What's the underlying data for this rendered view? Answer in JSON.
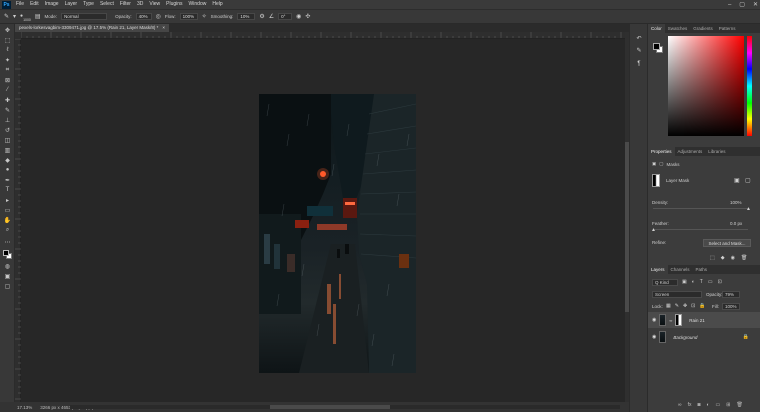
{
  "menu": {
    "logo": "Ps",
    "items": [
      "File",
      "Edit",
      "Image",
      "Layer",
      "Type",
      "Select",
      "Filter",
      "3D",
      "View",
      "Plugins",
      "Window",
      "Help"
    ]
  },
  "options": {
    "size": "1000",
    "mode_label": "Mode:",
    "mode_value": "Normal",
    "opacity_label": "Opacity:",
    "opacity_value": "40%",
    "flow_label": "Flow:",
    "flow_value": "100%",
    "smoothing_label": "Smoothing:",
    "smoothing_value": "10%",
    "angle_value": "0°"
  },
  "document": {
    "tab_title": "pexels-lorkesvagbim-3309471.jpg @ 17.5% (Rain 21, Layer Mask/8) *",
    "close": "×"
  },
  "status": {
    "zoom": "17.13%",
    "doc_info": "3266 px x 4653 px (72 ppi)"
  },
  "panel": {
    "color_tabs": [
      "Color",
      "Swatches",
      "Gradients",
      "Patterns"
    ],
    "properties_tabs": [
      "Properties",
      "Adjustments",
      "Libraries"
    ],
    "masks_label": "Masks",
    "layer_mask_label": "Layer Mask",
    "density_label": "Density:",
    "density_value": "100%",
    "feather_label": "Feather:",
    "feather_value": "0.0 px",
    "refine_label": "Refine:",
    "select_mask_button": "Select and Mask...",
    "layers_tabs": [
      "Layers",
      "Channels",
      "Paths"
    ],
    "filter_kind": "Q Kind",
    "blend_mode": "Screen",
    "opacity_label": "Opacity:",
    "opacity_value": "79%",
    "lock_label": "Lock:",
    "fill_label": "Fill:",
    "fill_value": "100%",
    "layers": [
      {
        "name": "Rain 21"
      },
      {
        "name": "Background"
      }
    ]
  },
  "colors": {
    "accent": "#31a8ff"
  }
}
